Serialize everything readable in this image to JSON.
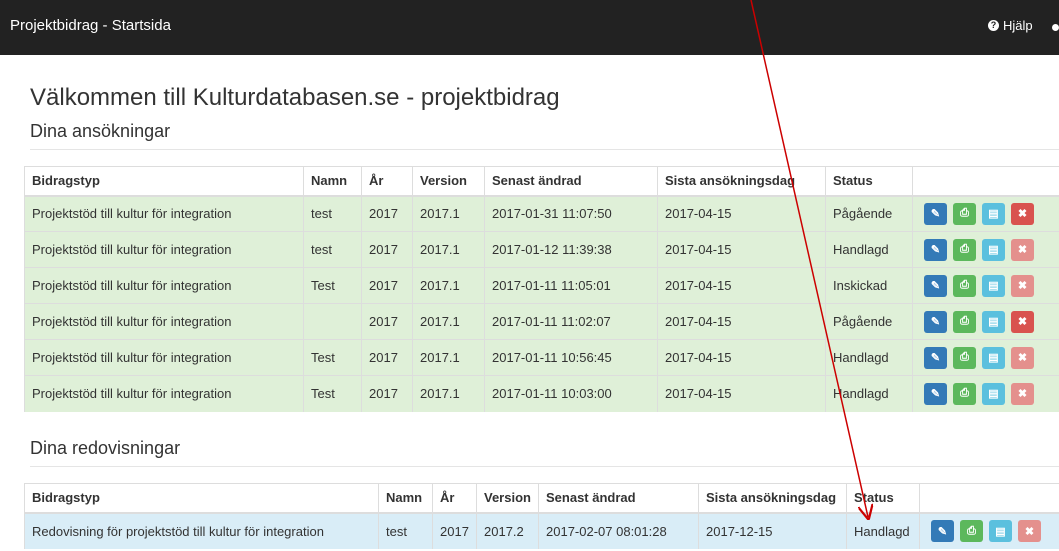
{
  "navbar": {
    "title": "Projektbidrag - Startsida",
    "help_label": "Hjälp"
  },
  "page": {
    "heading": "Välkommen till Kulturdatabasen.se - projektbidrag",
    "applications_heading": "Dina ansökningar",
    "reports_heading": "Dina redovisningar"
  },
  "applications": {
    "headers": [
      "Bidragstyp",
      "Namn",
      "År",
      "Version",
      "Senast ändrad",
      "Sista ansökningsdag",
      "Status",
      ""
    ],
    "rows": [
      [
        "Projektstöd till kultur för integration",
        "test",
        "2017",
        "2017.1",
        "2017-01-31 11:07:50",
        "2017-04-15",
        "Pågående"
      ],
      [
        "Projektstöd till kultur för integration",
        "test",
        "2017",
        "2017.1",
        "2017-01-12 11:39:38",
        "2017-04-15",
        "Handlagd"
      ],
      [
        "Projektstöd till kultur för integration",
        "Test",
        "2017",
        "2017.1",
        "2017-01-11 11:05:01",
        "2017-04-15",
        "Inskickad"
      ],
      [
        "Projektstöd till kultur för integration",
        "",
        "2017",
        "2017.1",
        "2017-01-11 11:02:07",
        "2017-04-15",
        "Pågående"
      ],
      [
        "Projektstöd till kultur för integration",
        "Test",
        "2017",
        "2017.1",
        "2017-01-11 10:56:45",
        "2017-04-15",
        "Handlagd"
      ],
      [
        "Projektstöd till kultur för integration",
        "Test",
        "2017",
        "2017.1",
        "2017-01-11 10:03:00",
        "2017-04-15",
        "Handlagd"
      ]
    ],
    "delete_enabled": [
      true,
      false,
      false,
      true,
      false,
      false
    ]
  },
  "reports": {
    "headers": [
      "Bidragstyp",
      "Namn",
      "År",
      "Version",
      "Senast ändrad",
      "Sista ansökningsdag",
      "Status",
      ""
    ],
    "rows": [
      [
        "Redovisning för projektstöd till kultur för integration",
        "test",
        "2017",
        "2017.2",
        "2017-02-07 08:01:28",
        "2017-12-15",
        "Handlagd"
      ]
    ],
    "delete_enabled": [
      false
    ]
  },
  "icons": {
    "edit": "pencil-icon",
    "print": "print-icon",
    "pdf": "pdf-icon",
    "delete": "close-icon",
    "help": "question-circle-icon",
    "user": "user-icon"
  },
  "colors": {
    "navbar": "#222222",
    "application_row": "#dff0d8",
    "report_row": "#d9edf7",
    "edit": "#337ab7",
    "print": "#5cb85c",
    "pdf": "#5bc0de",
    "delete": "#d9534f",
    "annotation_arrow": "#cc0000"
  }
}
